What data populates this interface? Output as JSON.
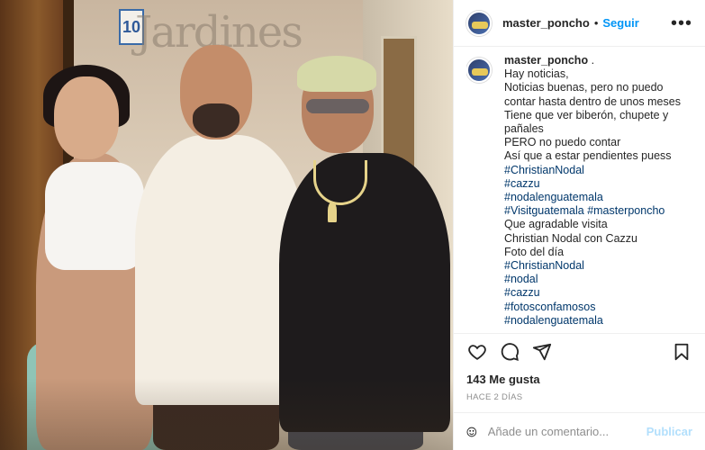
{
  "post": {
    "house_number": "10",
    "wall_sign": "Jardines"
  },
  "header": {
    "username": "master_poncho",
    "separator": "•",
    "follow_label": "Seguir",
    "more_label": "•••"
  },
  "caption": {
    "username": "master_poncho",
    "username_suffix": " .",
    "lines": [
      {
        "text": "Hay noticias,",
        "tag": false
      },
      {
        "text": "Noticias buenas, pero no puedo",
        "tag": false
      },
      {
        "text": "contar hasta dentro de unos meses",
        "tag": false
      },
      {
        "text": "Tiene que ver biberón, chupete y",
        "tag": false
      },
      {
        "text": "pañales",
        "tag": false
      },
      {
        "text": "PERO no puedo contar",
        "tag": false
      },
      {
        "text": "Así que a estar pendientes puess",
        "tag": false
      },
      {
        "text": "#ChristianNodal",
        "tag": true
      },
      {
        "text": "#cazzu",
        "tag": true
      },
      {
        "text": "#nodalenguatemala",
        "tag": true
      },
      {
        "text": "#Visitguatemala #masterponcho",
        "tag": true
      },
      {
        "text": "Que agradable visita",
        "tag": false
      },
      {
        "text": "Christian Nodal con Cazzu",
        "tag": false
      },
      {
        "text": "Foto del día",
        "tag": false
      },
      {
        "text": "#ChristianNodal",
        "tag": true
      },
      {
        "text": "#nodal",
        "tag": true
      },
      {
        "text": "#cazzu",
        "tag": true
      },
      {
        "text": "#fotosconfamosos",
        "tag": true
      },
      {
        "text": "#nodalenguatemala",
        "tag": true
      }
    ]
  },
  "stats": {
    "likes": "143 Me gusta",
    "time": "HACE 2 DÍAS"
  },
  "comment": {
    "placeholder": "Añade un comentario...",
    "publish_label": "Publicar"
  },
  "colors": {
    "link": "#0095f6",
    "hashtag": "#00376b",
    "publish_disabled": "#b2dffc"
  }
}
